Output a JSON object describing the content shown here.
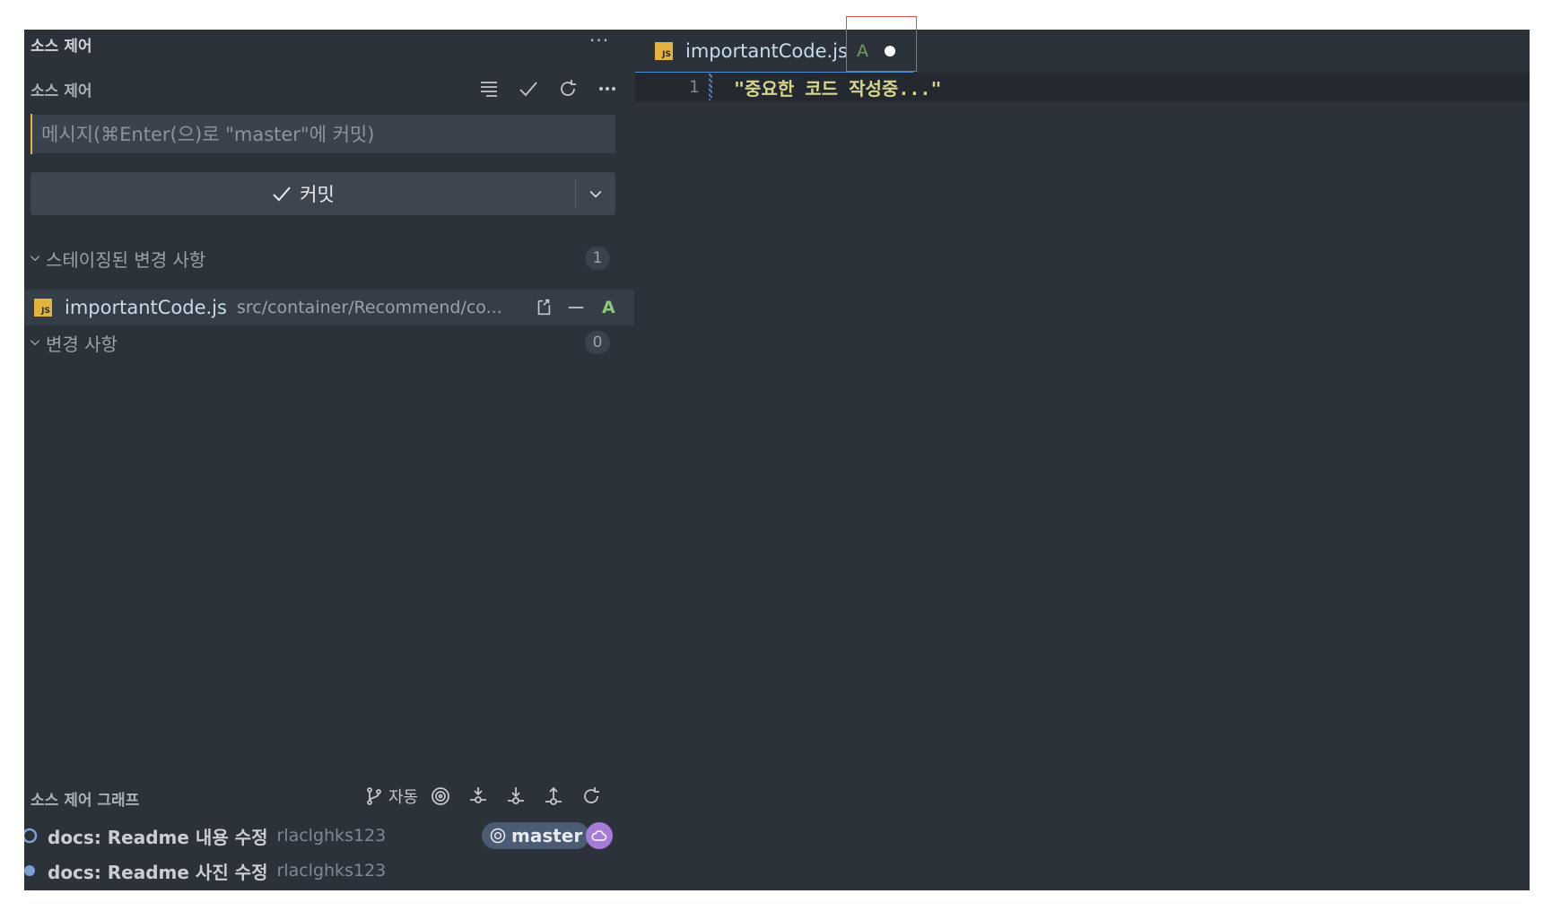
{
  "sidebar": {
    "header_title": "소스 제어",
    "header_more": "···",
    "sub_title": "소스 제어",
    "toolbar": {
      "icons": [
        "list-tree-icon",
        "check-icon",
        "refresh-icon",
        "more-icon"
      ],
      "more_label": "···"
    },
    "message": {
      "placeholder": "메시지(⌘Enter(으)로 \"master\"에 커밋)",
      "value": ""
    },
    "commit_button": {
      "label": "커밋"
    },
    "sections": {
      "staged": {
        "label": "스테이징된 변경 사항",
        "count": "1"
      },
      "changes": {
        "label": "변경 사항",
        "count": "0"
      }
    },
    "staged_files": [
      {
        "icon_text": "JS",
        "name": "importantCode.js",
        "path": "src/container/Recommend/co...",
        "status": "A"
      }
    ],
    "graph": {
      "title": "소스 제어 그래프",
      "auto_label": "자동",
      "commits": [
        {
          "message": "docs: Readme 내용 수정",
          "author": "rlaclghks123",
          "branch": "master"
        },
        {
          "message": "docs: Readme 사진 수정",
          "author": "rlaclghks123"
        }
      ]
    }
  },
  "editor": {
    "tab": {
      "icon_text": "JS",
      "name": "importantCode.js",
      "status": "A"
    },
    "lines": [
      {
        "number": "1",
        "text": "\"중요한 코드 작성중...\""
      }
    ]
  },
  "colors": {
    "background": "#2b323a",
    "accent": "#4d8fd1",
    "js_icon": "#e3b341",
    "added": "#8fc47c",
    "cloud": "#a57bd6",
    "highlight": "#d9534f"
  }
}
